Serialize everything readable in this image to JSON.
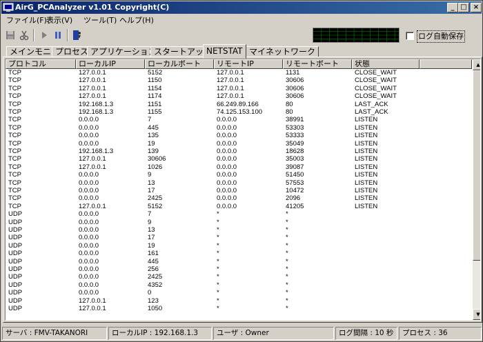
{
  "window": {
    "title": "AirG_PCAnalyzer v1.01 Copyright(C)",
    "minimize_label": "_",
    "maximize_label": "□",
    "close_label": "×"
  },
  "menu": [
    "ファイル(F)",
    "表示(V)",
    "ツール(T)",
    "ヘルプ(H)"
  ],
  "toolbar": {
    "icons": [
      "save-icon",
      "cut-icon",
      "play-icon",
      "pause-icon",
      "exit-icon"
    ],
    "monitor_color": "#00a000"
  },
  "autosave": {
    "label": "ログ自動保存",
    "checked": false
  },
  "tabs": [
    "メインモニタ",
    "プロセス",
    "アプリケーション",
    "スタートアップ",
    "NETSTAT",
    "マイネットワーク"
  ],
  "active_tab": "NETSTAT",
  "columns": [
    "プロトコル",
    "ローカルIP",
    "ローカルポート",
    "リモートIP",
    "リモートポート",
    "状態"
  ],
  "rows": [
    [
      "TCP",
      "127.0.0.1",
      "5152",
      "127.0.0.1",
      "1131",
      "CLOSE_WAIT"
    ],
    [
      "TCP",
      "127.0.0.1",
      "1150",
      "127.0.0.1",
      "30606",
      "CLOSE_WAIT"
    ],
    [
      "TCP",
      "127.0.0.1",
      "1154",
      "127.0.0.1",
      "30606",
      "CLOSE_WAIT"
    ],
    [
      "TCP",
      "127.0.0.1",
      "1174",
      "127.0.0.1",
      "30606",
      "CLOSE_WAIT"
    ],
    [
      "TCP",
      "192.168.1.3",
      "1151",
      "66.249.89.166",
      "80",
      "LAST_ACK"
    ],
    [
      "TCP",
      "192.168.1.3",
      "1155",
      "74.125.153.100",
      "80",
      "LAST_ACK"
    ],
    [
      "TCP",
      "0.0.0.0",
      "7",
      "0.0.0.0",
      "38991",
      "LISTEN"
    ],
    [
      "TCP",
      "0.0.0.0",
      "445",
      "0.0.0.0",
      "53303",
      "LISTEN"
    ],
    [
      "TCP",
      "0.0.0.0",
      "135",
      "0.0.0.0",
      "53333",
      "LISTEN"
    ],
    [
      "TCP",
      "0.0.0.0",
      "19",
      "0.0.0.0",
      "35049",
      "LISTEN"
    ],
    [
      "TCP",
      "192.168.1.3",
      "139",
      "0.0.0.0",
      "18628",
      "LISTEN"
    ],
    [
      "TCP",
      "127.0.0.1",
      "30606",
      "0.0.0.0",
      "35003",
      "LISTEN"
    ],
    [
      "TCP",
      "127.0.0.1",
      "1026",
      "0.0.0.0",
      "39087",
      "LISTEN"
    ],
    [
      "TCP",
      "0.0.0.0",
      "9",
      "0.0.0.0",
      "51450",
      "LISTEN"
    ],
    [
      "TCP",
      "0.0.0.0",
      "13",
      "0.0.0.0",
      "57553",
      "LISTEN"
    ],
    [
      "TCP",
      "0.0.0.0",
      "17",
      "0.0.0.0",
      "10472",
      "LISTEN"
    ],
    [
      "TCP",
      "0.0.0.0",
      "2425",
      "0.0.0.0",
      "2096",
      "LISTEN"
    ],
    [
      "TCP",
      "127.0.0.1",
      "5152",
      "0.0.0.0",
      "41205",
      "LISTEN"
    ],
    [
      "UDP",
      "0.0.0.0",
      "7",
      "*",
      "*",
      ""
    ],
    [
      "UDP",
      "0.0.0.0",
      "9",
      "*",
      "*",
      ""
    ],
    [
      "UDP",
      "0.0.0.0",
      "13",
      "*",
      "*",
      ""
    ],
    [
      "UDP",
      "0.0.0.0",
      "17",
      "*",
      "*",
      ""
    ],
    [
      "UDP",
      "0.0.0.0",
      "19",
      "*",
      "*",
      ""
    ],
    [
      "UDP",
      "0.0.0.0",
      "161",
      "*",
      "*",
      ""
    ],
    [
      "UDP",
      "0.0.0.0",
      "445",
      "*",
      "*",
      ""
    ],
    [
      "UDP",
      "0.0.0.0",
      "256",
      "*",
      "*",
      ""
    ],
    [
      "UDP",
      "0.0.0.0",
      "2425",
      "*",
      "*",
      ""
    ],
    [
      "UDP",
      "0.0.0.0",
      "4352",
      "*",
      "*",
      ""
    ],
    [
      "UDP",
      "0.0.0.0",
      "0",
      "*",
      "*",
      ""
    ],
    [
      "UDP",
      "127.0.0.1",
      "123",
      "*",
      "*",
      ""
    ],
    [
      "UDP",
      "127.0.0.1",
      "1050",
      "*",
      "*",
      ""
    ]
  ],
  "status": {
    "server": "サーバ : FMV-TAKANORI",
    "local_ip": "ローカルIP : 192.168.1.3",
    "user": "ユーザ : Owner",
    "interval": "ログ間隔 : 10 秒",
    "process": "プロセス : 36"
  }
}
